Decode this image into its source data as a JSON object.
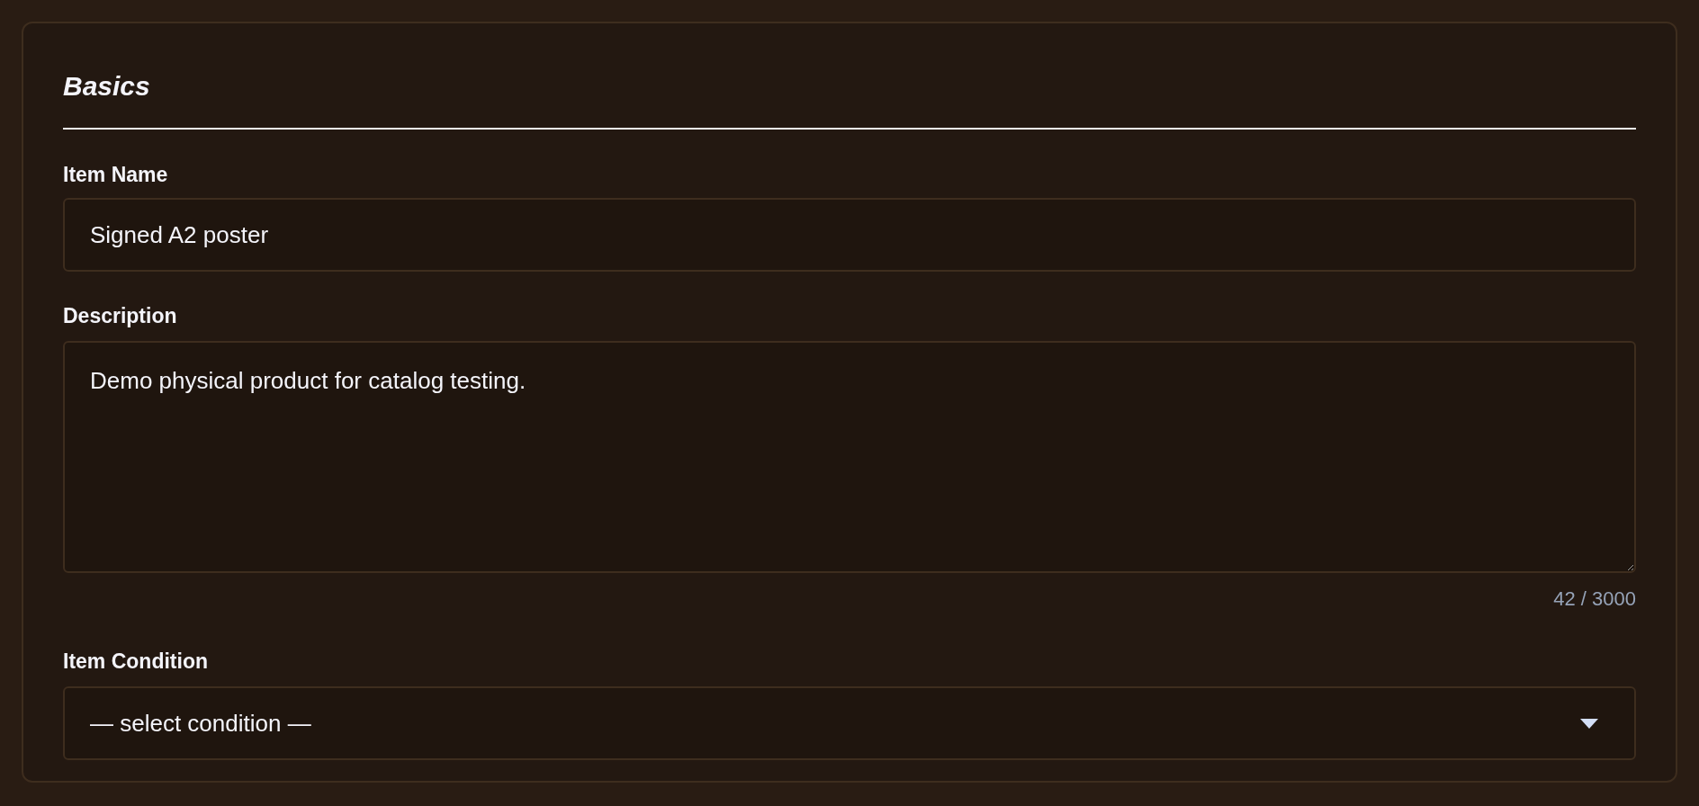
{
  "section": {
    "title": "Basics"
  },
  "item_name": {
    "label": "Item Name",
    "value": "Signed A2 poster"
  },
  "description": {
    "label": "Description",
    "value": "Demo physical product for catalog testing.",
    "counter": "42 / 3000"
  },
  "item_condition": {
    "label": "Item Condition",
    "value": "— select condition —"
  }
}
